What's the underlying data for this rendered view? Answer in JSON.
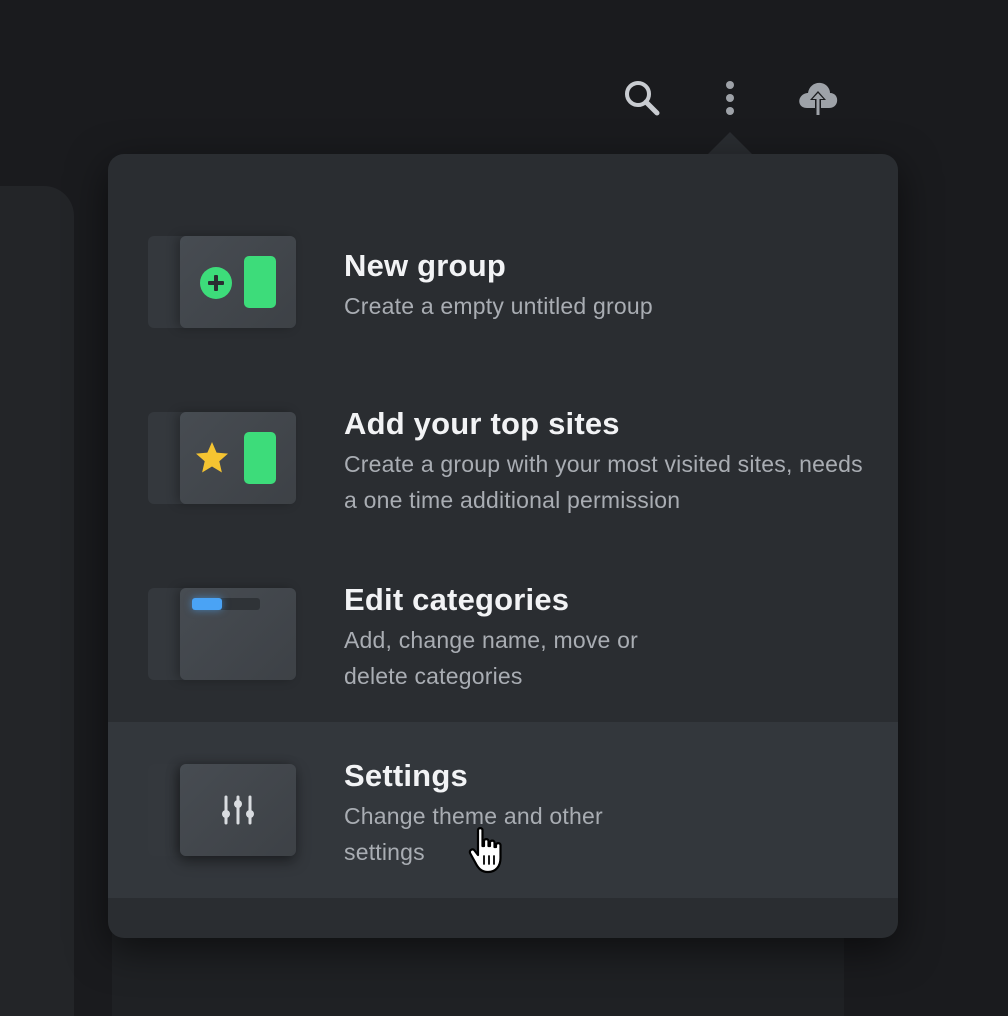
{
  "toolbar": {
    "icons": [
      "search-icon",
      "more-vertical-icon",
      "cloud-upload-icon"
    ]
  },
  "menu": {
    "items": [
      {
        "title": "New group",
        "description": "Create a empty untitled group",
        "icon": "plus-circle-icon"
      },
      {
        "title": "Add your top sites",
        "description": "Create a group with your most visited sites, needs a one time additional permission",
        "icon": "star-icon"
      },
      {
        "title": "Edit categories",
        "description": "Add, change name, move or delete categories",
        "icon": "category-bar-icon"
      },
      {
        "title": "Settings",
        "description": "Change theme and other settings",
        "icon": "sliders-icon"
      }
    ],
    "highlighted_index": 3
  },
  "colors": {
    "background": "#1a1b1e",
    "menu_background": "#2a2d31",
    "menu_highlight": "#33373c",
    "accent_green": "#3ddc7a",
    "accent_yellow": "#f5c431",
    "accent_blue": "#4aa3f5",
    "title_text": "#f2f3f5",
    "description_text": "#a9adb3"
  }
}
